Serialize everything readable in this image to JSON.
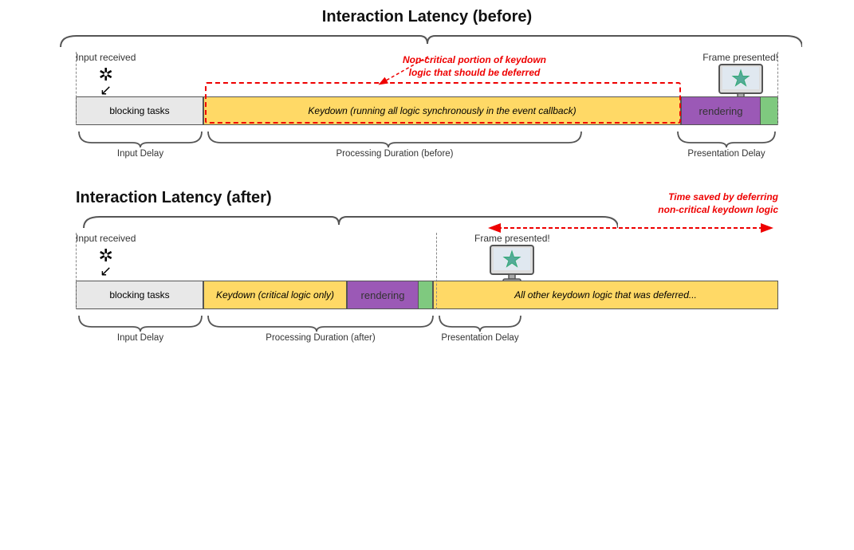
{
  "section1": {
    "title": "Interaction Latency (before)",
    "input_label": "Input received",
    "frame_label": "Frame presented!",
    "blocking_label": "blocking tasks",
    "keydown_label": "Keydown (running all logic synchronously in the event callback)",
    "rendering_label": "rendering",
    "input_delay_label": "Input Delay",
    "processing_duration_label": "Processing Duration (before)",
    "presentation_delay_label": "Presentation Delay",
    "non_critical_label": "Non-critical portion of keydown\nlogic that should be deferred"
  },
  "section2": {
    "title": "Interaction Latency (after)",
    "input_label": "Input received",
    "frame_label": "Frame presented!",
    "blocking_label": "blocking tasks",
    "keydown_label": "Keydown (critical logic only)",
    "rendering_label": "rendering",
    "deferred_label": "All other keydown logic that was deferred...",
    "input_delay_label": "Input Delay",
    "processing_duration_label": "Processing Duration (after)",
    "presentation_delay_label": "Presentation Delay",
    "time_saved_label": "Time saved by deferring\nnon-critical keydown logic"
  }
}
